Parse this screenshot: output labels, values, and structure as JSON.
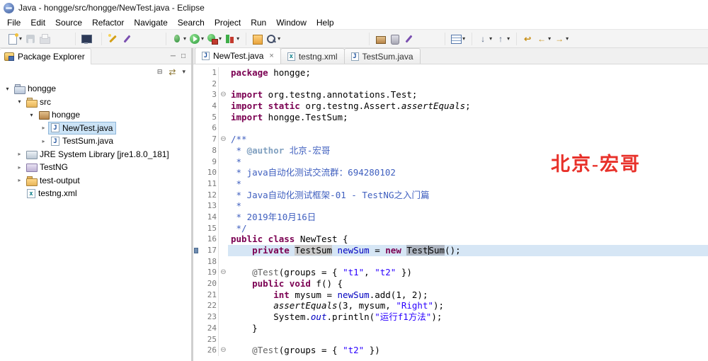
{
  "colors": {
    "watermark_red": "#e8312a",
    "keyword_purple": "#7b0052",
    "string_blue": "#2a00ff",
    "javadoc_blue": "#3f5fbf",
    "current_line": "#d6e6f5"
  },
  "window": {
    "title": "Java - hongge/src/hongge/NewTest.java - Eclipse"
  },
  "menu": {
    "items": [
      "File",
      "Edit",
      "Source",
      "Refactor",
      "Navigate",
      "Search",
      "Project",
      "Run",
      "Window",
      "Help"
    ]
  },
  "toolbar": {
    "groups": [
      {
        "gap": 0,
        "icons": [
          {
            "name": "new-wizard",
            "type": "sheet",
            "dropdown": true
          },
          {
            "name": "save",
            "type": "floppy",
            "disabled": true
          },
          {
            "name": "print",
            "type": "printer",
            "disabled": true
          }
        ]
      },
      {
        "gap": 28,
        "icons": [
          {
            "name": "open-console",
            "type": "monitor"
          }
        ]
      },
      {
        "gap": 6,
        "icons": [
          {
            "name": "external-tools-wand",
            "type": "wand"
          },
          {
            "name": "format-pen",
            "type": "wand2"
          }
        ]
      },
      {
        "gap": 40,
        "icons": [
          {
            "name": "debug",
            "type": "bug",
            "dropdown": true
          },
          {
            "name": "run",
            "type": "run",
            "dropdown": true
          },
          {
            "name": "run-external",
            "type": "runext",
            "dropdown": true
          },
          {
            "name": "coverage",
            "type": "cov",
            "dropdown": true
          }
        ]
      },
      {
        "gap": 2,
        "icons": [
          {
            "name": "open-type",
            "type": "type"
          },
          {
            "name": "search",
            "type": "mag",
            "dropdown": true
          }
        ]
      },
      {
        "gap": 118,
        "icons": [
          {
            "name": "new-package",
            "type": "pkg"
          },
          {
            "name": "new-jar",
            "type": "jar"
          },
          {
            "name": "clean-wand",
            "type": "wand2"
          }
        ]
      },
      {
        "gap": 36,
        "icons": [
          {
            "name": "sort-table",
            "type": "table",
            "dropdown": true
          }
        ]
      },
      {
        "gap": 2,
        "icons": [
          {
            "name": "next-annotation",
            "type": "text",
            "glyph": "↓",
            "color": "#5a6a88",
            "dropdown": true
          },
          {
            "name": "prev-annotation",
            "type": "text",
            "glyph": "↑",
            "color": "#5a6a88",
            "dropdown": true
          }
        ]
      },
      {
        "gap": 2,
        "icons": [
          {
            "name": "last-edit-location",
            "type": "text",
            "glyph": "↩",
            "color": "#c89018"
          },
          {
            "name": "back",
            "type": "text",
            "glyph": "←",
            "color": "#c89018",
            "dropdown": true
          },
          {
            "name": "forward",
            "type": "text",
            "glyph": "→",
            "color": "#c89018",
            "dropdown": true
          }
        ]
      }
    ]
  },
  "package_explorer": {
    "title": "Package Explorer",
    "tree": [
      {
        "label": "hongge",
        "depth": 0,
        "state": "expanded",
        "icon": "project"
      },
      {
        "label": "src",
        "depth": 1,
        "state": "expanded",
        "icon": "src"
      },
      {
        "label": "hongge",
        "depth": 2,
        "state": "expanded",
        "icon": "package"
      },
      {
        "label": "NewTest.java",
        "depth": 3,
        "state": "collapsed",
        "icon": "file",
        "letter": "J",
        "kind": "java",
        "selected": true
      },
      {
        "label": "TestSum.java",
        "depth": 3,
        "state": "collapsed",
        "icon": "file",
        "letter": "J",
        "kind": "java"
      },
      {
        "label": "JRE System Library [jre1.8.0_181]",
        "depth": 1,
        "state": "collapsed",
        "icon": "jre"
      },
      {
        "label": "TestNG",
        "depth": 1,
        "state": "collapsed",
        "icon": "lib"
      },
      {
        "label": "test-output",
        "depth": 1,
        "state": "collapsed",
        "icon": "folder"
      },
      {
        "label": "testng.xml",
        "depth": 1,
        "state": "leaf",
        "icon": "file",
        "letter": "x",
        "kind": "xml"
      }
    ]
  },
  "editor": {
    "tabs": [
      {
        "label": "NewTest.java",
        "letter": "J",
        "kind": "java",
        "active": true
      },
      {
        "label": "testng.xml",
        "letter": "x",
        "kind": "xml",
        "active": false
      },
      {
        "label": "TestSum.java",
        "letter": "J",
        "kind": "java",
        "active": false
      }
    ],
    "watermark": "北京-宏哥",
    "code": {
      "lines": [
        {
          "n": 1,
          "tokens": [
            [
              "kw",
              "package"
            ],
            [
              "pl",
              " hongge;"
            ]
          ]
        },
        {
          "n": 2,
          "tokens": []
        },
        {
          "n": 3,
          "fold": true,
          "tokens": [
            [
              "kw",
              "import"
            ],
            [
              "pl",
              " org.testng.annotations.Test;"
            ]
          ]
        },
        {
          "n": 4,
          "tokens": [
            [
              "kw",
              "import static"
            ],
            [
              "pl",
              " org.testng.Assert."
            ],
            [
              "it",
              "assertEquals"
            ],
            [
              "pl",
              ";"
            ]
          ]
        },
        {
          "n": 5,
          "tokens": [
            [
              "kw",
              "import"
            ],
            [
              "pl",
              " hongge.TestSum;"
            ]
          ]
        },
        {
          "n": 6,
          "tokens": []
        },
        {
          "n": 7,
          "fold": true,
          "tokens": [
            [
              "doc",
              "/**"
            ]
          ]
        },
        {
          "n": 8,
          "tokens": [
            [
              "doc",
              " * "
            ],
            [
              "dockw",
              "@author"
            ],
            [
              "doc",
              " 北京-宏哥"
            ]
          ]
        },
        {
          "n": 9,
          "tokens": [
            [
              "doc",
              " * "
            ]
          ]
        },
        {
          "n": 10,
          "tokens": [
            [
              "doc",
              " * java自动化测试交流群：694280102"
            ]
          ]
        },
        {
          "n": 11,
          "tokens": [
            [
              "doc",
              " * "
            ]
          ]
        },
        {
          "n": 12,
          "tokens": [
            [
              "doc",
              " * Java自动化测试框架-01 - TestNG之入门篇"
            ]
          ]
        },
        {
          "n": 13,
          "tokens": [
            [
              "doc",
              " * "
            ]
          ]
        },
        {
          "n": 14,
          "tokens": [
            [
              "doc",
              " * 2019年10月16日"
            ]
          ]
        },
        {
          "n": 15,
          "tokens": [
            [
              "doc",
              " */"
            ]
          ]
        },
        {
          "n": 16,
          "tokens": [
            [
              "kw",
              "public class"
            ],
            [
              "pl",
              " NewTest {"
            ]
          ]
        },
        {
          "n": 17,
          "current": true,
          "marker": true,
          "tokens": [
            [
              "pl",
              "    "
            ],
            [
              "kw",
              "private"
            ],
            [
              "pl",
              " "
            ],
            [
              "occ",
              "TestSum"
            ],
            [
              "pl",
              " "
            ],
            [
              "fld",
              "newSum"
            ],
            [
              "pl",
              " = "
            ],
            [
              "kw",
              "new"
            ],
            [
              "pl",
              " "
            ],
            [
              "occ2",
              "Test"
            ],
            [
              "cur",
              ""
            ],
            [
              "occ2",
              "Sum"
            ],
            [
              "pl",
              "();"
            ]
          ]
        },
        {
          "n": 18,
          "tokens": []
        },
        {
          "n": 19,
          "fold": true,
          "tokens": [
            [
              "pl",
              "    "
            ],
            [
              "ann",
              "@Test"
            ],
            [
              "pl",
              "(groups = { "
            ],
            [
              "str",
              "\"t1\""
            ],
            [
              "pl",
              ", "
            ],
            [
              "str",
              "\"t2\""
            ],
            [
              "pl",
              " })"
            ]
          ]
        },
        {
          "n": 20,
          "tokens": [
            [
              "pl",
              "    "
            ],
            [
              "kw",
              "public void"
            ],
            [
              "pl",
              " f() {"
            ]
          ]
        },
        {
          "n": 21,
          "tokens": [
            [
              "pl",
              "        "
            ],
            [
              "kw",
              "int"
            ],
            [
              "pl",
              " mysum = "
            ],
            [
              "fld",
              "newSum"
            ],
            [
              "pl",
              ".add(1, 2);"
            ]
          ]
        },
        {
          "n": 22,
          "tokens": [
            [
              "pl",
              "        "
            ],
            [
              "it",
              "assertEquals"
            ],
            [
              "pl",
              "(3, mysum, "
            ],
            [
              "str",
              "\"Right\""
            ],
            [
              "pl",
              ");"
            ]
          ]
        },
        {
          "n": 23,
          "tokens": [
            [
              "pl",
              "        System."
            ],
            [
              "sfld",
              "out"
            ],
            [
              "pl",
              ".println("
            ],
            [
              "str",
              "\"运行f1方法\""
            ],
            [
              "pl",
              ");"
            ]
          ]
        },
        {
          "n": 24,
          "tokens": [
            [
              "pl",
              "    }"
            ]
          ]
        },
        {
          "n": 25,
          "tokens": []
        },
        {
          "n": 26,
          "fold": true,
          "tokens": [
            [
              "pl",
              "    "
            ],
            [
              "ann",
              "@Test"
            ],
            [
              "pl",
              "(groups = { "
            ],
            [
              "str",
              "\"t2\""
            ],
            [
              "pl",
              " })"
            ]
          ]
        }
      ]
    }
  }
}
